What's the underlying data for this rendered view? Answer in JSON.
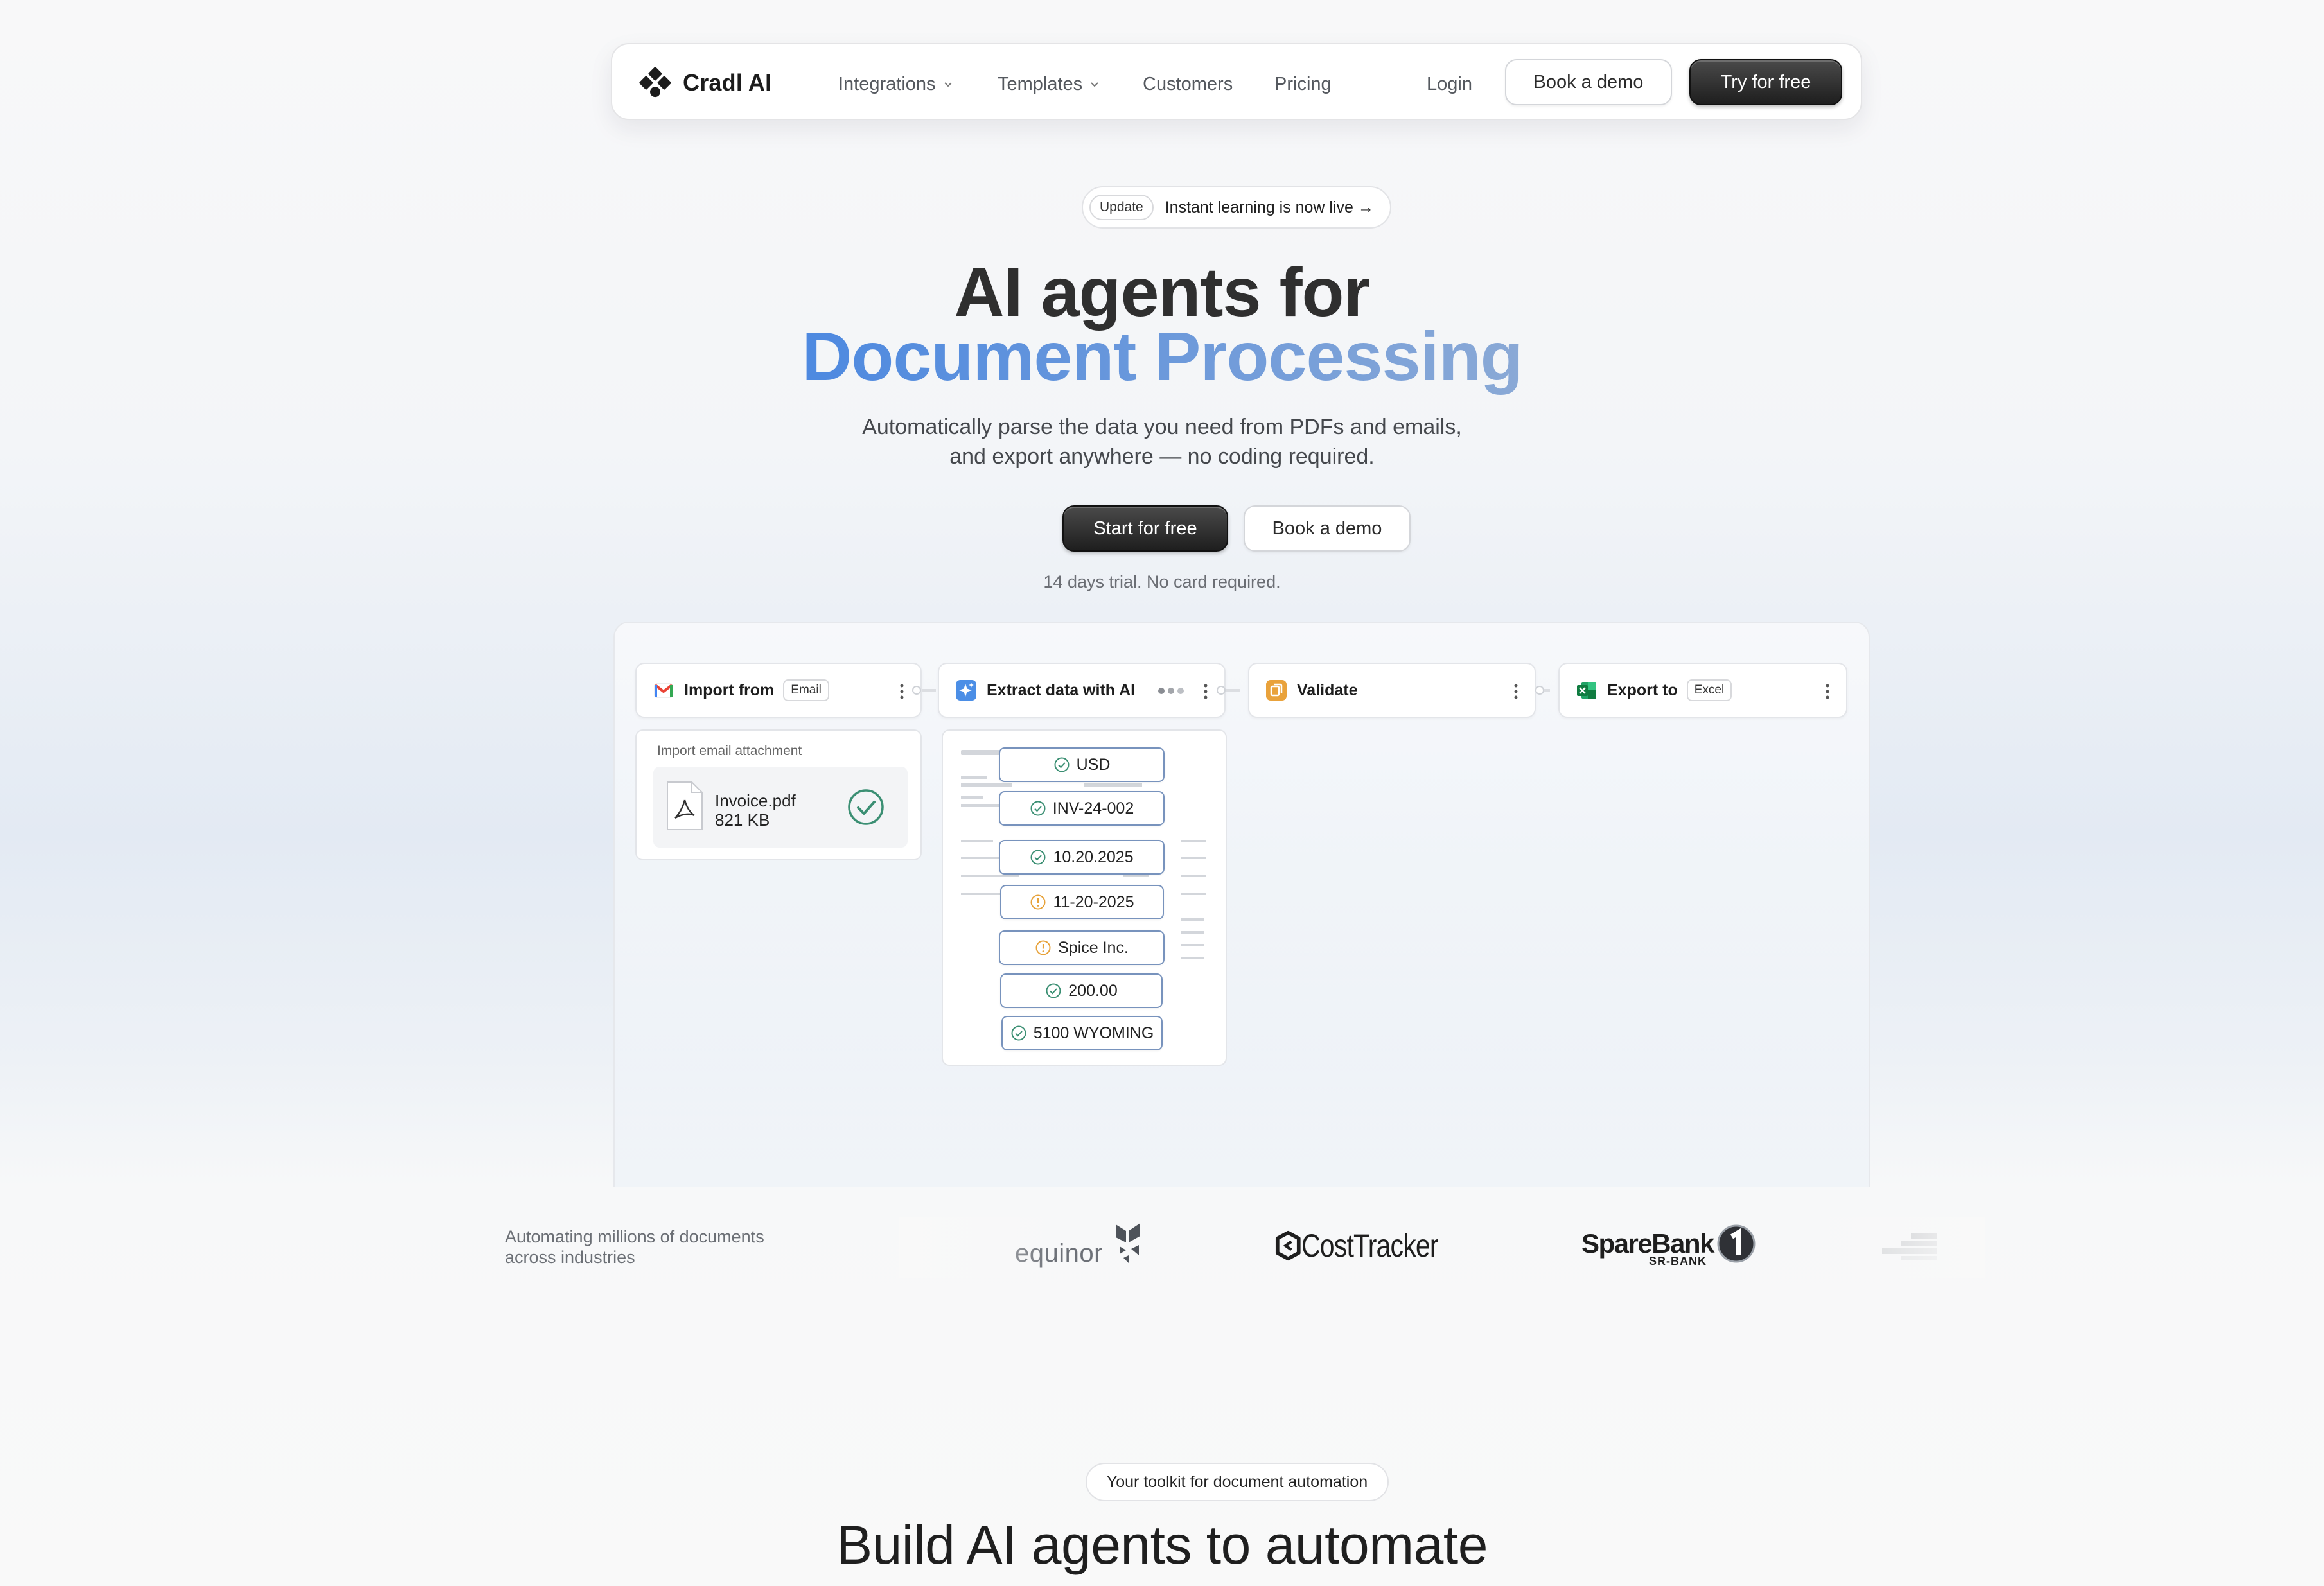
{
  "nav": {
    "brand": "Cradl AI",
    "links": [
      {
        "label": "Integrations",
        "dropdown": true
      },
      {
        "label": "Templates",
        "dropdown": true
      },
      {
        "label": "Customers",
        "dropdown": false
      },
      {
        "label": "Pricing",
        "dropdown": false
      }
    ],
    "login": "Login",
    "book_demo": "Book a demo",
    "try_free": "Try for free"
  },
  "hero": {
    "badge": "Update",
    "announcement": "Instant learning is now live →",
    "title_line1": "AI agents for",
    "title_line2": "Document Processing",
    "subtitle_line1": "Automatically parse the data you need from PDFs and emails,",
    "subtitle_line2": "and export anywhere — no coding required.",
    "cta_primary": "Start for free",
    "cta_secondary": "Book a demo",
    "trial_note": "14 days trial. No card required."
  },
  "workflow": {
    "steps": [
      {
        "label": "Import from",
        "tag": "Email",
        "icon": "gmail-icon"
      },
      {
        "label": "Extract data with AI",
        "icon": "sparkle-icon"
      },
      {
        "label": "Validate",
        "icon": "validate-icon"
      },
      {
        "label": "Export to",
        "tag": "Excel",
        "icon": "excel-icon"
      }
    ],
    "import_caption": "Import email attachment",
    "file": {
      "name": "Invoice.pdf",
      "size": "821 KB"
    },
    "extracted_fields": [
      {
        "value": "USD",
        "status": "ok"
      },
      {
        "value": "INV-24-002",
        "status": "ok"
      },
      {
        "value": "10.20.2025",
        "status": "ok"
      },
      {
        "value": "11-20-2025",
        "status": "warn"
      },
      {
        "value": "Spice Inc.",
        "status": "warn"
      },
      {
        "value": "200.00",
        "status": "ok"
      },
      {
        "value": "5100 WYOMING",
        "status": "ok"
      }
    ],
    "status_colors": {
      "ok": "#3b8f73",
      "warn": "#e7a23a"
    }
  },
  "logos": {
    "caption_line1": "Automating millions of documents",
    "caption_line2": "across industries",
    "items": [
      "equinor",
      "CostTracker",
      "SpareBank",
      "SR-BANK"
    ]
  },
  "toolkit": {
    "pill": "Your toolkit for document automation",
    "heading": "Build AI agents to automate"
  },
  "colors": {
    "accent_blue": "#4d89e0",
    "dark_button": "#1e1e1e"
  }
}
